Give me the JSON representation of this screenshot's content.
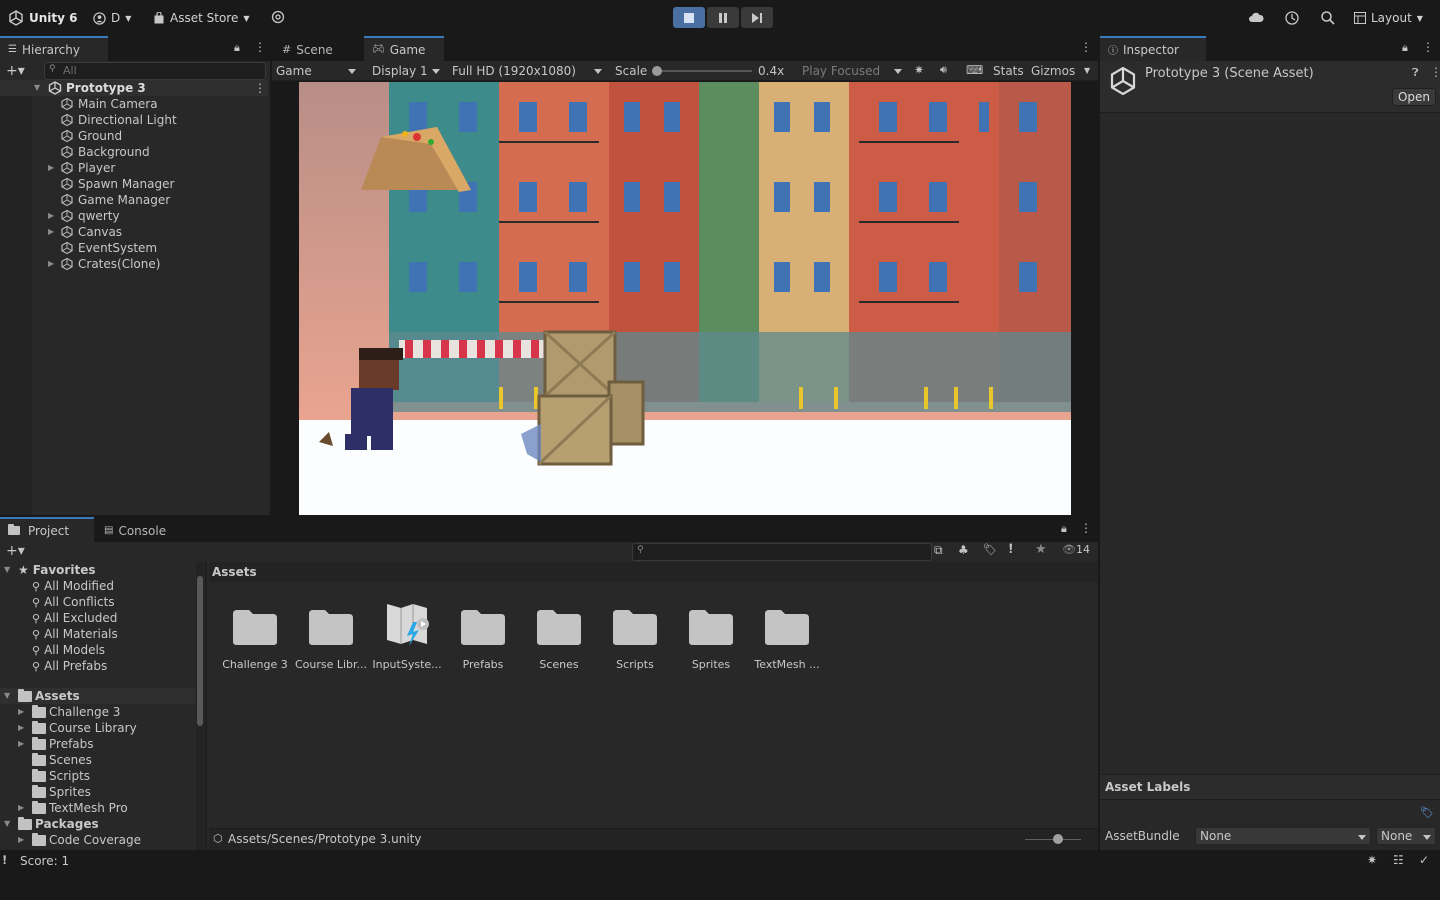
{
  "toolbar": {
    "app_name": "Unity 6",
    "account": "D",
    "asset_store": "Asset Store",
    "layout": "Layout"
  },
  "hierarchy": {
    "tab": "Hierarchy",
    "search_placeholder": "All",
    "root": "Prototype 3",
    "items": [
      {
        "label": "Main Camera",
        "expandable": false
      },
      {
        "label": "Directional Light",
        "expandable": false
      },
      {
        "label": "Ground",
        "expandable": false
      },
      {
        "label": "Background",
        "expandable": false
      },
      {
        "label": "Player",
        "expandable": true
      },
      {
        "label": "Spawn Manager",
        "expandable": false
      },
      {
        "label": "Game Manager",
        "expandable": false
      },
      {
        "label": "qwerty",
        "expandable": true
      },
      {
        "label": "Canvas",
        "expandable": true
      },
      {
        "label": "EventSystem",
        "expandable": false
      },
      {
        "label": "Crates(Clone)",
        "expandable": true
      }
    ]
  },
  "game_view": {
    "tabs": [
      "Scene",
      "Game"
    ],
    "active_tab": "Game",
    "mode": "Game",
    "display": "Display 1",
    "resolution": "Full HD (1920x1080)",
    "scale_label": "Scale",
    "scale_value": "0.4x",
    "play_focus": "Play Focused",
    "stats": "Stats",
    "gizmos": "Gizmos"
  },
  "inspector": {
    "tab": "Inspector",
    "title": "Prototype 3 (Scene Asset)",
    "open_button": "Open",
    "asset_labels": "Asset Labels",
    "asset_bundle_label": "AssetBundle",
    "asset_bundle_value": "None",
    "asset_bundle_variant": "None"
  },
  "project": {
    "tabs": [
      "Project",
      "Console"
    ],
    "hidden_count": "14",
    "favorites_header": "Favorites",
    "favorites": [
      "All Modified",
      "All Conflicts",
      "All Excluded",
      "All Materials",
      "All Models",
      "All Prefabs"
    ],
    "assets_header": "Assets",
    "asset_folders": [
      {
        "label": "Challenge 3",
        "expandable": true
      },
      {
        "label": "Course Library",
        "expandable": true
      },
      {
        "label": "Prefabs",
        "expandable": true
      },
      {
        "label": "Scenes",
        "expandable": false
      },
      {
        "label": "Scripts",
        "expandable": false
      },
      {
        "label": "Sprites",
        "expandable": false
      },
      {
        "label": "TextMesh Pro",
        "expandable": true
      }
    ],
    "packages_header": "Packages",
    "packages": [
      "Code Coverage"
    ],
    "breadcrumb": "Assets",
    "grid_items": [
      "Challenge 3",
      "Course Libr...",
      "InputSyste...",
      "Prefabs",
      "Scenes",
      "Scripts",
      "Sprites",
      "TextMesh ..."
    ],
    "path": "Assets/Scenes/Prototype 3.unity"
  },
  "status": {
    "text": "Score: 1"
  }
}
